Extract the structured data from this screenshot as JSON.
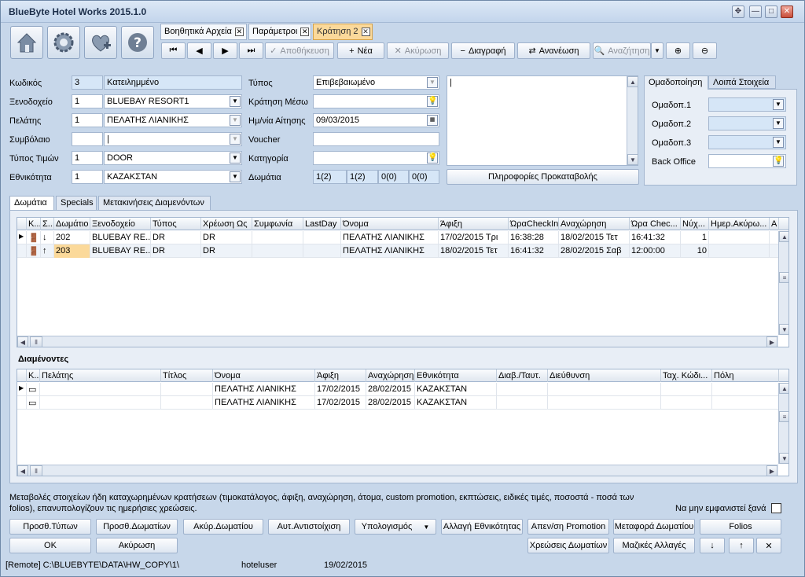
{
  "window": {
    "title": "BlueByte Hotel Works 2015.1.0"
  },
  "doc_tabs": [
    {
      "label": "Βοηθητικά Αρχεία"
    },
    {
      "label": "Παράμετροι"
    },
    {
      "label": "Κράτηση 2"
    }
  ],
  "toolbar": {
    "save": "Αποθήκευση",
    "new": "Νέα",
    "cancel": "Ακύρωση",
    "delete": "Διαγραφή",
    "refresh": "Ανανέωση",
    "search": "Αναζήτηση"
  },
  "form": {
    "code_label": "Κωδικός",
    "code": "3",
    "code_desc": "Κατειλημμένο",
    "hotel_label": "Ξενοδοχείο",
    "hotel_code": "1",
    "hotel": "BLUEBAY RESORT1",
    "client_label": "Πελάτης",
    "client_code": "1",
    "client": "ΠΕΛΑΤΗΣ ΛΙΑΝΙΚΗΣ",
    "contract_label": "Συμβόλαιο",
    "pricetype_label": "Τύπος Τιμών",
    "pricetype_code": "1",
    "pricetype": "DOOR",
    "nationality_label": "Εθνικότητα",
    "nationality_code": "1",
    "nationality": "ΚΑΖΑΚΣΤΑΝ",
    "type_label": "Τύπος",
    "type": "Επιβεβαιωμένο",
    "via_label": "Κράτηση Μέσω",
    "reqdate_label": "Ημ/νία Αίτησης",
    "reqdate": "09/03/2015",
    "voucher_label": "Voucher",
    "category_label": "Κατηγορία",
    "rooms_label": "Δωμάτια",
    "rooms": [
      "1(2)",
      "1(2)",
      "0(0)",
      "0(0)"
    ],
    "prepay_button": "Πληροφορίες Προκαταβολής"
  },
  "right_panel": {
    "tabs": [
      "Ομαδοποίηση",
      "Λοιπά Στοιχεία"
    ],
    "fields": [
      "Ομαδοπ.1",
      "Ομαδοπ.2",
      "Ομαδοπ.3",
      "Back Office"
    ]
  },
  "section_tabs": [
    "Δωμάτια",
    "Specials",
    "Μετακινήσεις Διαμενόντων"
  ],
  "rooms_grid": {
    "columns": [
      "Κ...",
      "Σ...",
      "Δωμάτιο",
      "Ξενοδοχείο",
      "Τύπος",
      "Χρέωση Ως",
      "Συμφωνία",
      "LastDay",
      "Όνομα",
      "Άφιξη",
      "ΏραCheckIn",
      "Αναχώρηση",
      "Ώρα Chec...",
      "Νύχ...",
      "Ημερ.Ακύρω...",
      "Α"
    ],
    "rows": [
      [
        "",
        "",
        "202",
        "BLUEBAY RE...",
        "DR",
        "DR",
        "",
        "",
        "ΠΕΛΑΤΗΣ ΛΙΑΝΙΚΗΣ",
        "17/02/2015 Τρι",
        "16:38:28",
        "18/02/2015 Τετ",
        "16:41:32",
        "1",
        "",
        ""
      ],
      [
        "",
        "",
        "203",
        "BLUEBAY RE...",
        "DR",
        "DR",
        "",
        "",
        "ΠΕΛΑΤΗΣ ΛΙΑΝΙΚΗΣ",
        "18/02/2015 Τετ",
        "16:41:32",
        "28/02/2015 Σαβ",
        "12:00:00",
        "10",
        "",
        ""
      ]
    ]
  },
  "guests_title": "Διαμένοντες",
  "guests_grid": {
    "columns": [
      "Κ...",
      "Πελάτης",
      "Τίτλος",
      "Όνομα",
      "Άφιξη",
      "Αναχώρηση",
      "Εθνικότητα",
      "Διαβ./Ταυτ.",
      "Διεύθυνση",
      "Ταχ. Κώδι...",
      "Πόλη"
    ],
    "rows": [
      [
        "",
        "",
        "",
        "ΠΕΛΑΤΗΣ ΛΙΑΝΙΚΗΣ",
        "17/02/2015",
        "28/02/2015",
        "ΚΑΖΑΚΣΤΑΝ",
        "",
        "",
        "",
        ""
      ],
      [
        "",
        "",
        "",
        "ΠΕΛΑΤΗΣ ΛΙΑΝΙΚΗΣ",
        "17/02/2015",
        "28/02/2015",
        "ΚΑΖΑΚΣΤΑΝ",
        "",
        "",
        "",
        ""
      ]
    ]
  },
  "info_text": "Μεταβολές στοιχείων ήδη καταχωρημένων κρατήσεων (τιμοκατάλογος, άφιξη, αναχώρηση, άτομα, custom promotion, εκπτώσεις, ειδικές τιμές, ποσοστά - ποσά των folios), επανυπολογίζουν τις ημερήσιες χρεώσεις.",
  "dont_show": "Να μην εμφανιστεί ξανά",
  "buttons": {
    "add_types": "Προσθ.Τύπων",
    "add_rooms": "Προσθ.Δωματίων",
    "cancel_room": "Ακύρ.Δωματίου",
    "auto_match": "Αυτ.Αντιστοίχιση",
    "calculate": "Υπολογισμός",
    "change_nat": "Αλλαγή Εθνικότητας",
    "promo": "Απεν/ση Promotion",
    "move_room": "Μεταφορά Δωματίου",
    "folios": "Folios",
    "ok": "OK",
    "cancel": "Ακύρωση",
    "room_charges": "Χρεώσεις Δωματίων",
    "bulk": "Μαζικές Αλλαγές"
  },
  "status": {
    "path": "[Remote] C:\\BLUEBYTE\\DATA\\HW_COPY\\1\\",
    "user": "hoteluser",
    "date": "19/02/2015"
  },
  "colors": {
    "accent": "#fbd99a",
    "field_blue": "#d6e6f7",
    "window_bg": "#c7d7ea"
  }
}
